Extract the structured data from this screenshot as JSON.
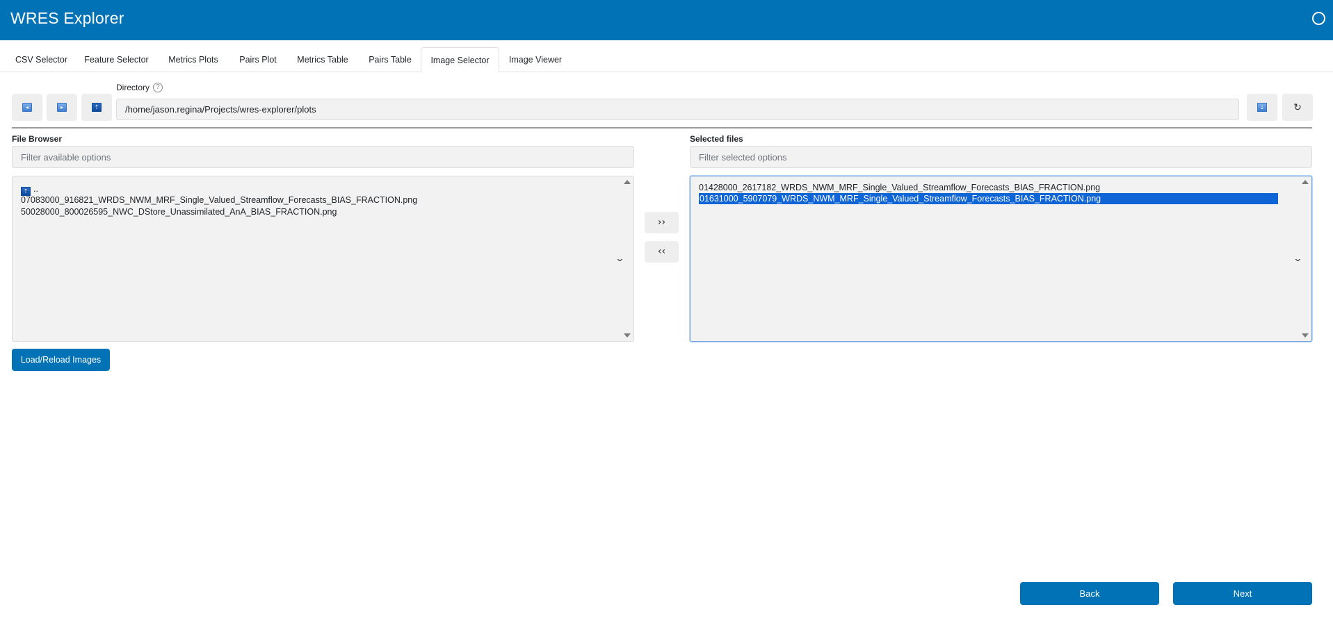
{
  "app": {
    "title": "WRES Explorer"
  },
  "tabs": [
    {
      "label": "CSV Selector"
    },
    {
      "label": "Feature Selector"
    },
    {
      "label": "Metrics Plots"
    },
    {
      "label": "Pairs Plot"
    },
    {
      "label": "Metrics Table"
    },
    {
      "label": "Pairs Table"
    },
    {
      "label": "Image Selector",
      "active": true
    },
    {
      "label": "Image Viewer"
    }
  ],
  "directory": {
    "label": "Directory",
    "help_icon": "?",
    "value": "/home/jason.regina/Projects/wres-explorer/plots",
    "back_icon": "◂",
    "forward_icon": "▸",
    "up_icon": "⇡",
    "go_icon": "⇣",
    "refresh_icon": "↻"
  },
  "file_browser": {
    "label": "File Browser",
    "filter_placeholder": "Filter available options",
    "parent_entry": "..",
    "items": [
      "07083000_916821_WRDS_NWM_MRF_Single_Valued_Streamflow_Forecasts_BIAS_FRACTION.png",
      "50028000_800026595_NWC_DStore_Unassimilated_AnA_BIAS_FRACTION.png"
    ]
  },
  "selected_files": {
    "label": "Selected files",
    "filter_placeholder": "Filter selected options",
    "items": [
      "01428000_2617182_WRDS_NWM_MRF_Single_Valued_Streamflow_Forecasts_BIAS_FRACTION.png",
      "01631000_5907079_WRDS_NWM_MRF_Single_Valued_Streamflow_Forecasts_BIAS_FRACTION.png"
    ],
    "selected_index": 1
  },
  "transfer": {
    "add_label": "››",
    "remove_label": "‹‹"
  },
  "actions": {
    "load_label": "Load/Reload Images",
    "back_label": "Back",
    "next_label": "Next"
  },
  "colors": {
    "accent": "#0072b5",
    "selection": "#0f65d6"
  }
}
